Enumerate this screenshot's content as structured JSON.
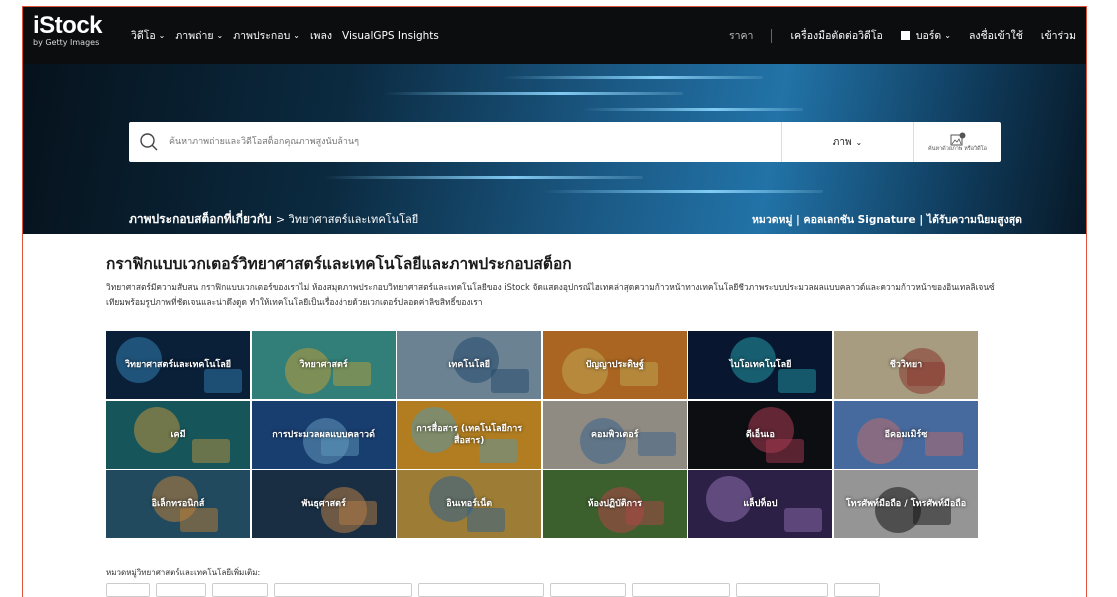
{
  "nav": {
    "logo": "iStock",
    "logo_sub": "by Getty Images",
    "left": [
      {
        "label": "วิดีโอ",
        "chevron": true
      },
      {
        "label": "ภาพถ่าย",
        "chevron": true
      },
      {
        "label": "ภาพประกอบ",
        "chevron": true
      },
      {
        "label": "เพลง",
        "chevron": false
      },
      {
        "label": "VisualGPS Insights",
        "chevron": false
      }
    ],
    "price": "ราคา",
    "video_editor": "เครื่องมือตัดต่อวิดีโอ",
    "boards": "บอร์ด",
    "signin": "ลงชื่อเข้าใช้",
    "join": "เข้าร่วม"
  },
  "search": {
    "placeholder": "ค้นหาภาพถ่ายและวิดีโอสต็อกคุณภาพสูงนับล้านๆ",
    "type": "ภาพ",
    "image_search": "ค้นหาด้วยภาพ หรือวิดีโอ"
  },
  "breadcrumb": {
    "prefix": "ภาพประกอบสต็อกที่เกี่ยวกับ",
    "current": "> วิทยาศาสตร์และเทคโนโลยี",
    "right": "หมวดหมู่ | คอลเลกชัน Signature | ได้รับความนิยมสูงสุด"
  },
  "main": {
    "title": "กราฟิกแบบเวกเตอร์วิทยาศาสตร์และเทคโนโลยีและภาพประกอบสต็อก",
    "description": "วิทยาศาสตร์มีความสับสน กราฟิกแบบเวกเตอร์ของเราไม่ ห้องสมุดภาพประกอบวิทยาศาสตร์และเทคโนโลยีของ iStock จัดแสดงอุปกรณ์ไฮเทคล่าสุดความก้าวหน้าทางเทคโนโลยีชีวภาพระบบประมวลผลแบบคลาวด์และความก้าวหน้าของอินเทลลิเจนซ์เทียมพร้อมรูปภาพที่ชัดเจนและน่าดึงดูด ทำให้เทคโนโลยีเป็นเรื่องง่ายด้วยเวกเตอร์ปลอดค่าลิขสิทธิ์ของเรา",
    "more_label": "หมวดหมู่วิทยาศาสตร์และเทคโนโลยีเพิ่มเติม:"
  },
  "tiles": [
    {
      "label": "วิทยาศาสตร์และเทคโนโลยี",
      "bg": "#0d2a4a",
      "accent": "#3fa0e0"
    },
    {
      "label": "วิทยาศาสตร์",
      "bg": "#3fa39a",
      "accent": "#f2c94c"
    },
    {
      "label": "เทคโนโลยี",
      "bg": "#8aa7bd",
      "accent": "#2e5c8a"
    },
    {
      "label": "ปัญญาประดิษฐ์",
      "bg": "#d9822b",
      "accent": "#f5d76e"
    },
    {
      "label": "ไบโอเทคโนโลยี",
      "bg": "#0b1e3d",
      "accent": "#2ec4d6"
    },
    {
      "label": "ชีววิทยา",
      "bg": "#d6c8a4",
      "accent": "#b0453a"
    },
    {
      "label": "เคมี",
      "bg": "#1d6f74",
      "accent": "#f2b950"
    },
    {
      "label": "การประมวลผลแบบคลาวด์",
      "bg": "#1f4f8f",
      "accent": "#7cc3f0"
    },
    {
      "label": "การสื่อสาร (เทคโนโลยีการสื่อสาร)",
      "bg": "#e3a12a",
      "accent": "#6fc1d9"
    },
    {
      "label": "คอมพิวเตอร์",
      "bg": "#b8b2a8",
      "accent": "#4b7fb0"
    },
    {
      "label": "ดีเอ็นเอ",
      "bg": "#111318",
      "accent": "#d84a6a"
    },
    {
      "label": "อีคอมเมิร์ซ",
      "bg": "#5a88c9",
      "accent": "#f28c8c"
    },
    {
      "label": "อิเล็กทรอนิกส์",
      "bg": "#2b5f7a",
      "accent": "#f0a34a"
    },
    {
      "label": "พันธุศาสตร์",
      "bg": "#203c57",
      "accent": "#e8a15a"
    },
    {
      "label": "อินเทอร์เน็ต",
      "bg": "#c9a046",
      "accent": "#3b7bb8"
    },
    {
      "label": "ห้องปฏิบัติการ",
      "bg": "#4c7a3a",
      "accent": "#e05b5b"
    },
    {
      "label": "แล็ปท็อป",
      "bg": "#3a2a5c",
      "accent": "#b58ad9"
    },
    {
      "label": "โทรศัพท์มือถือ / โทรศัพท์มือถือ",
      "bg": "#bfbfbf",
      "accent": "#1a1a1a"
    }
  ],
  "chips": [
    44,
    50,
    56,
    138,
    126,
    76,
    98,
    92,
    46
  ]
}
